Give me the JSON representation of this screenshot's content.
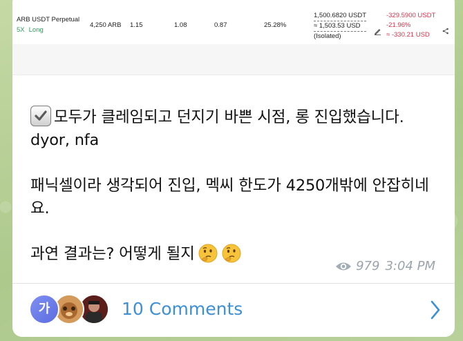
{
  "position": {
    "pair": "ARB USDT Perpetual",
    "leverage": "5X",
    "side": "Long",
    "size": "4,250 ARB",
    "entry_price": "1.15",
    "mark_price": "1.08",
    "liq_price": "0.87",
    "margin_ratio": "25.28%",
    "margin_usdt": "1,500.6820 USDT",
    "margin_usd": "≈ 1,503.53 USD",
    "margin_mode": "(Isolated)",
    "pnl_usdt": "-329.5900 USDT",
    "pnl_pct": "-21.96%",
    "pnl_usd": "≈ -330.21 USD"
  },
  "message": {
    "line1": "모두가 클레임되고 던지기 바쁜 시점, 롱 진입했습니다. dyor, nfa",
    "line2": "패닉셀이라 생각되어 진입, 멕씨 한도가 4250개밖에 안잡히네요.",
    "line3": "과연 결과는? 어떻게 될지",
    "views": "979",
    "time": "3:04 PM"
  },
  "comments": {
    "avatar1_initial": "가",
    "label": "10 Comments"
  },
  "icons": [
    "check-mark-button-emoji",
    "thinking-face-emoji",
    "eye-icon",
    "edit-icon",
    "share-icon",
    "chevron-right-icon"
  ],
  "colors": {
    "long_green": "#2e9c5a",
    "loss_red": "#d6334b",
    "link_blue": "#3d8fd6",
    "meta_gray": "#9aa4ad"
  }
}
